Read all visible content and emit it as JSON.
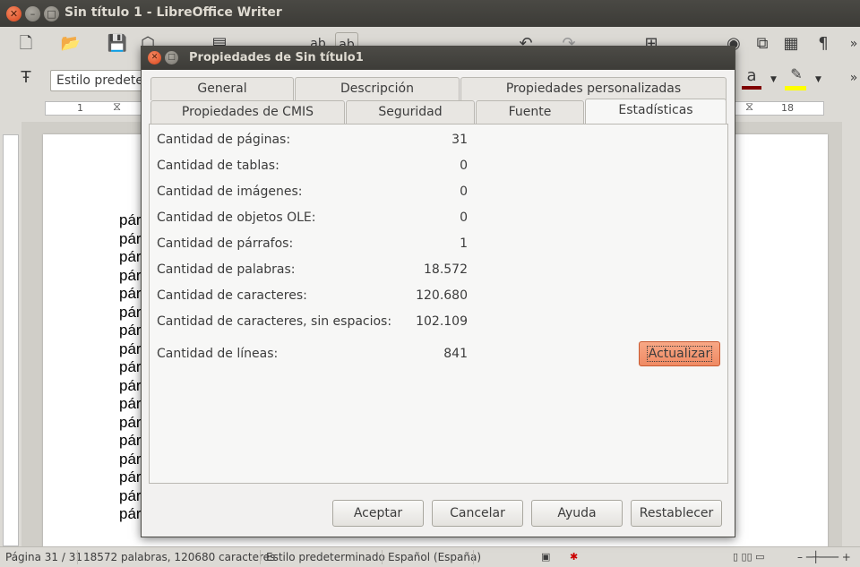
{
  "window": {
    "title": "Sin título 1 - LibreOffice Writer"
  },
  "toolbar": {
    "paragraph_style": "Estilo predeterminado",
    "ruler_left_number": "1",
    "ruler_right_number": "18"
  },
  "document": {
    "line_text": "pár",
    "visible_lines": 17
  },
  "statusbar": {
    "page": "Página 31 / 31",
    "words": "18572 palabras, 120680 caracteres",
    "style": "Estilo predeterminado",
    "language": "Español (España)"
  },
  "dialog": {
    "title": "Propiedades de Sin título1",
    "tabs_row1": [
      "General",
      "Descripción",
      "Propiedades personalizadas"
    ],
    "tabs_row2": [
      "Propiedades de CMIS",
      "Seguridad",
      "Fuente",
      "Estadísticas"
    ],
    "active_tab": "Estadísticas",
    "stats": [
      {
        "label": "Cantidad de páginas:",
        "value": "31"
      },
      {
        "label": "Cantidad de tablas:",
        "value": "0"
      },
      {
        "label": "Cantidad de imágenes:",
        "value": "0"
      },
      {
        "label": "Cantidad de objetos OLE:",
        "value": "0"
      },
      {
        "label": "Cantidad de párrafos:",
        "value": "1"
      },
      {
        "label": "Cantidad de palabras:",
        "value": "18.572"
      },
      {
        "label": "Cantidad de caracteres:",
        "value": "120.680"
      },
      {
        "label": "Cantidad de caracteres, sin espacios:",
        "value": "102.109"
      },
      {
        "label": "Cantidad de líneas:",
        "value": "841"
      }
    ],
    "update_button": "Actualizar",
    "buttons": {
      "ok": "Aceptar",
      "cancel": "Cancelar",
      "help": "Ayuda",
      "reset": "Restablecer"
    }
  },
  "colors": {
    "accent": "#ef8a63",
    "titlebar": "#3c3b37",
    "font_color_swatch": "#800000",
    "highlight_swatch": "#ffff00"
  }
}
